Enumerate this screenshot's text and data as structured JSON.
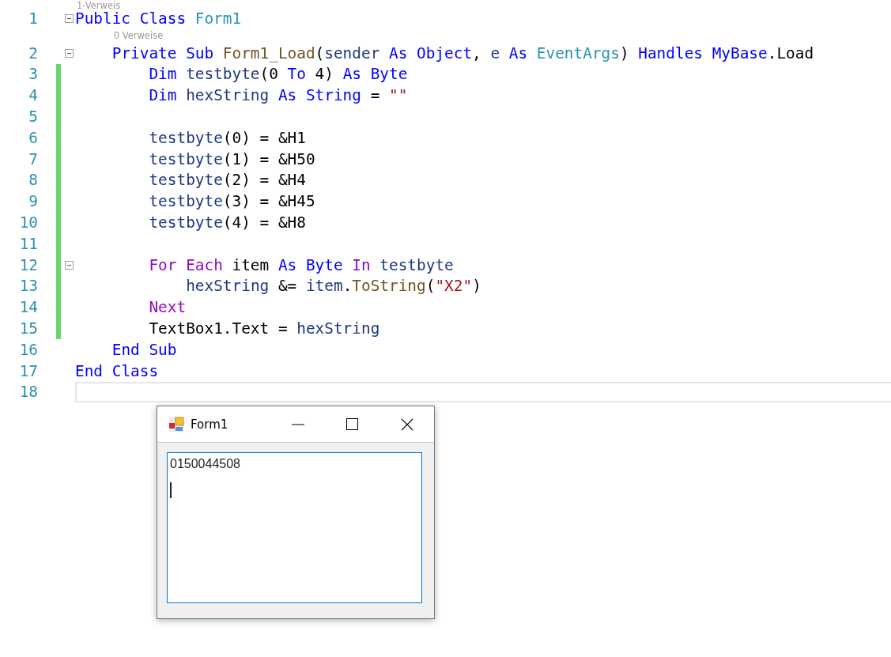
{
  "editor": {
    "lines": [
      {
        "number": "1",
        "codelens": "1-Verweis",
        "changed": false,
        "current": false,
        "expanded": true,
        "tokens": [
          {
            "kind": "keyword",
            "text": "Public"
          },
          {
            "kind": "keyword",
            "text": " Class"
          },
          {
            "kind": "type",
            "text": " Form1"
          }
        ],
        "children": [
          {
            "number": "2",
            "codelens": "0 Verweise",
            "changed": false,
            "current": false,
            "expanded": true,
            "tokens": [
              {
                "kind": "keyword",
                "text": "Private"
              },
              {
                "kind": "keyword",
                "text": " Sub"
              },
              {
                "kind": "method",
                "text": " Form1_Load"
              },
              {
                "kind": "plain",
                "text": "("
              },
              {
                "kind": "variable",
                "text": "sender"
              },
              {
                "kind": "keyword",
                "text": " As"
              },
              {
                "kind": "keyword",
                "text": " Object"
              },
              {
                "kind": "plain",
                "text": ","
              },
              {
                "kind": "variable",
                "text": " e"
              },
              {
                "kind": "keyword",
                "text": " As"
              },
              {
                "kind": "type",
                "text": " EventArgs"
              },
              {
                "kind": "plain",
                "text": ")"
              },
              {
                "kind": "keyword",
                "text": " Handles"
              },
              {
                "kind": "keyword",
                "text": " MyBase"
              },
              {
                "kind": "plain",
                "text": ".Load"
              }
            ],
            "children": [
              {
                "number": "3",
                "changed": true,
                "current": false,
                "tokens": [
                  {
                    "kind": "keyword",
                    "text": "Dim"
                  },
                  {
                    "kind": "variable",
                    "text": " testbyte"
                  },
                  {
                    "kind": "plain",
                    "text": "(0"
                  },
                  {
                    "kind": "keyword",
                    "text": " To"
                  },
                  {
                    "kind": "plain",
                    "text": " 4)"
                  },
                  {
                    "kind": "keyword",
                    "text": " As"
                  },
                  {
                    "kind": "keyword",
                    "text": " Byte"
                  }
                ]
              },
              {
                "number": "4",
                "changed": true,
                "current": false,
                "tokens": [
                  {
                    "kind": "keyword",
                    "text": "Dim"
                  },
                  {
                    "kind": "variable",
                    "text": " hexString"
                  },
                  {
                    "kind": "keyword",
                    "text": " As"
                  },
                  {
                    "kind": "keyword",
                    "text": " String"
                  },
                  {
                    "kind": "plain",
                    "text": " ="
                  },
                  {
                    "kind": "string",
                    "text": " \"\""
                  }
                ]
              },
              {
                "number": "5",
                "changed": true,
                "current": false
              },
              {
                "number": "6",
                "changed": true,
                "current": false,
                "tokens": [
                  {
                    "kind": "variable",
                    "text": "testbyte"
                  },
                  {
                    "kind": "plain",
                    "text": "(0) = &H1"
                  }
                ]
              },
              {
                "number": "7",
                "changed": true,
                "current": false,
                "tokens": [
                  {
                    "kind": "variable",
                    "text": "testbyte"
                  },
                  {
                    "kind": "plain",
                    "text": "(1) = &H50"
                  }
                ]
              },
              {
                "number": "8",
                "changed": true,
                "current": false,
                "tokens": [
                  {
                    "kind": "variable",
                    "text": "testbyte"
                  },
                  {
                    "kind": "plain",
                    "text": "(2) = &H4"
                  }
                ]
              },
              {
                "number": "9",
                "changed": true,
                "current": false,
                "tokens": [
                  {
                    "kind": "variable",
                    "text": "testbyte"
                  },
                  {
                    "kind": "plain",
                    "text": "(3) = &H45"
                  }
                ]
              },
              {
                "number": "10",
                "changed": true,
                "current": false,
                "tokens": [
                  {
                    "kind": "variable",
                    "text": "testbyte"
                  },
                  {
                    "kind": "plain",
                    "text": "(4) = &H8"
                  }
                ]
              },
              {
                "number": "11",
                "changed": true,
                "current": false
              },
              {
                "number": "12",
                "changed": true,
                "current": false,
                "expanded": true,
                "tokens": [
                  {
                    "kind": "control",
                    "text": "For"
                  },
                  {
                    "kind": "control",
                    "text": " Each"
                  },
                  {
                    "kind": "plain",
                    "text": " item"
                  },
                  {
                    "kind": "keyword",
                    "text": " As"
                  },
                  {
                    "kind": "keyword",
                    "text": " Byte"
                  },
                  {
                    "kind": "control",
                    "text": " In"
                  },
                  {
                    "kind": "variable",
                    "text": " testbyte"
                  }
                ],
                "children": [
                  {
                    "number": "13",
                    "changed": true,
                    "current": false,
                    "tokens": [
                      {
                        "kind": "variable",
                        "text": "hexString"
                      },
                      {
                        "kind": "plain",
                        "text": " &="
                      },
                      {
                        "kind": "variable",
                        "text": " item"
                      },
                      {
                        "kind": "plain",
                        "text": "."
                      },
                      {
                        "kind": "method",
                        "text": "ToString"
                      },
                      {
                        "kind": "plain",
                        "text": "("
                      },
                      {
                        "kind": "string",
                        "text": "\"X2\""
                      },
                      {
                        "kind": "plain",
                        "text": ")"
                      }
                    ]
                  }
                ]
              },
              {
                "number": "14",
                "changed": true,
                "current": false,
                "tokens": [
                  {
                    "kind": "control",
                    "text": "Next"
                  }
                ]
              },
              {
                "number": "15",
                "changed": true,
                "current": false,
                "tokens": [
                  {
                    "kind": "plain",
                    "text": "TextBox1.Text ="
                  },
                  {
                    "kind": "variable",
                    "text": " hexString"
                  }
                ]
              }
            ]
          },
          {
            "number": "16",
            "changed": false,
            "current": false,
            "tokens": [
              {
                "kind": "keyword",
                "text": "End"
              },
              {
                "kind": "keyword",
                "text": " Sub"
              }
            ]
          }
        ]
      },
      {
        "number": "17",
        "changed": false,
        "current": false,
        "tokens": [
          {
            "kind": "keyword",
            "text": "End"
          },
          {
            "kind": "keyword",
            "text": " Class"
          }
        ]
      },
      {
        "number": "18",
        "changed": false,
        "current": true
      }
    ]
  },
  "form_window": {
    "title": "Form1",
    "textbox": {
      "value": "0150044508"
    }
  }
}
